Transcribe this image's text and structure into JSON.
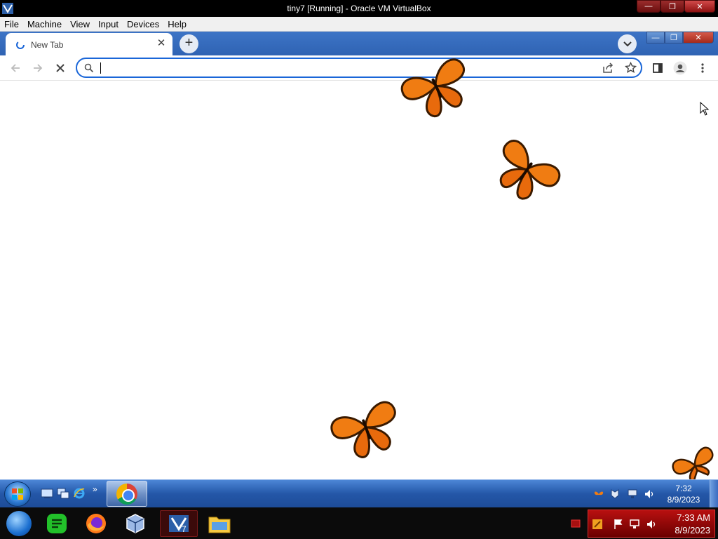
{
  "host_window": {
    "title": "tiny7 [Running] - Oracle VM VirtualBox",
    "menu": [
      "File",
      "Machine",
      "View",
      "Input",
      "Devices",
      "Help"
    ]
  },
  "browser": {
    "tab_title": "New Tab",
    "omnibox_value": "",
    "page_state": "loading"
  },
  "guest_taskbar": {
    "clock_time": "7:32",
    "clock_date": "8/9/2023"
  },
  "host_taskbar": {
    "clock_time": "7:33 AM",
    "clock_date": "8/9/2023"
  },
  "colors": {
    "omnibox_focus": "#1a66d8",
    "tabstrip": "#2f63b3",
    "host_tray": "#b81010"
  }
}
